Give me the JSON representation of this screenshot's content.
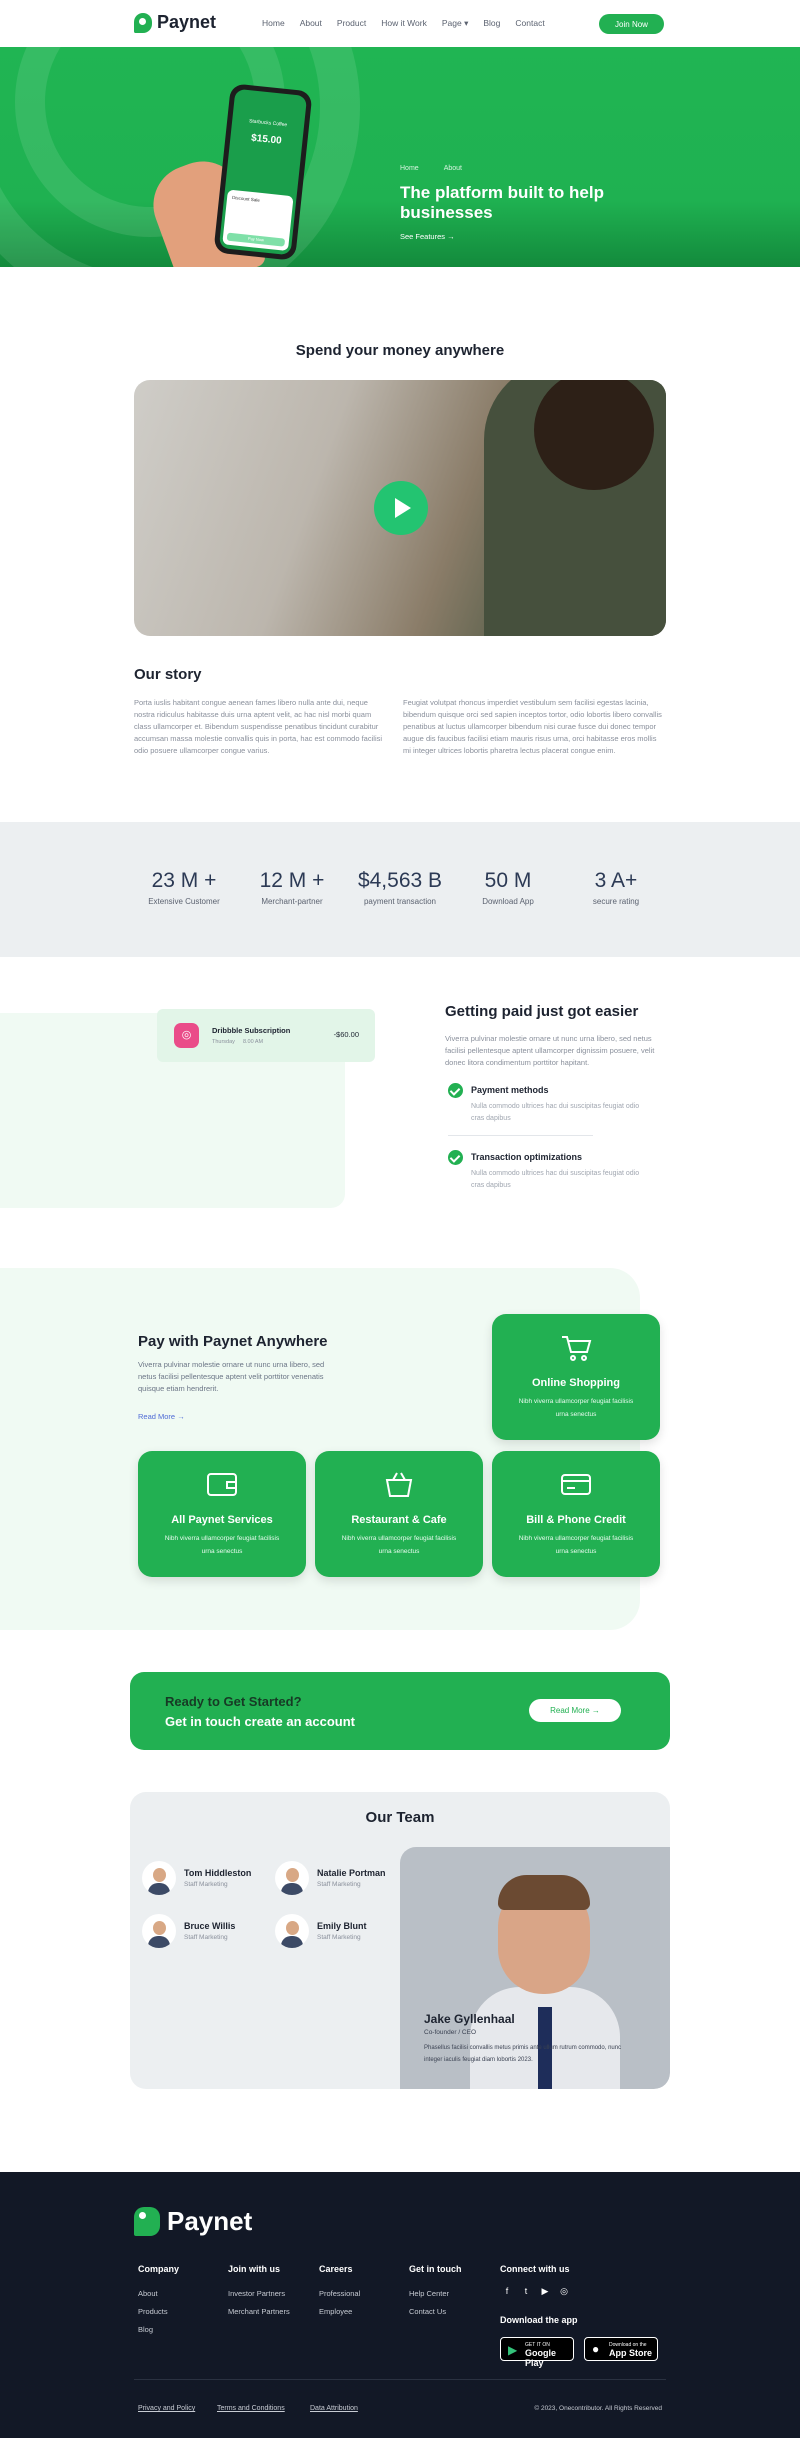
{
  "nav": {
    "brand": "Paynet",
    "menu": [
      "Home",
      "About",
      "Product",
      "How it Work",
      "Page",
      "Blog",
      "Contact"
    ],
    "join_label": "Join Now"
  },
  "hero": {
    "crumb_home": "Home",
    "crumb_current": "About",
    "title": "The platform built to help businesses",
    "link_label": "See Features",
    "phone": {
      "header": "Starbucks Coffee",
      "amount": "$15.00",
      "label": "Discount Sale",
      "button": "Pay Now"
    }
  },
  "spend": {
    "title": "Spend your money anywhere"
  },
  "story": {
    "title": "Our story",
    "col1": "Porta iuslis habitant congue aenean fames libero nulla ante dui, neque nostra ridiculus habitasse duis urna aptent velit, ac hac nisl morbi quam class ullamcorper et. Bibendum suspendisse penatibus tincidunt curabitur accumsan massa molestie convallis quis in porta, hac est commodo facilisi odio posuere ullamcorper congue varius.",
    "col2": "Feugiat volutpat rhoncus imperdiet vestibulum sem facilisi egestas lacinia, bibendum quisque orci sed sapien inceptos tortor, odio lobortis libero convallis penatibus at luctus ullamcorper bibendum nisi curae fusce dui donec tempor augue dis faucibus facilisi etiam mauris risus urna, orci habitasse eros mollis mi integer ultrices lobortis pharetra lectus placerat congue enim."
  },
  "stats": [
    {
      "value": "23 M +",
      "label": "Extensive Customer"
    },
    {
      "value": "12 M +",
      "label": "Merchant-partner"
    },
    {
      "value": "$4,563 B",
      "label": "payment transaction"
    },
    {
      "value": "50 M",
      "label": "Download App"
    },
    {
      "value": "3 A+",
      "label": "secure rating"
    }
  ],
  "getting_paid": {
    "title": "Getting paid just got easier",
    "text": "Viverra pulvinar molestie ornare ut nunc urna libero, sed netus facilisi pellentesque aptent ullamcorper dignissim posuere, velit donec litora condimentum porttitor hapitant.",
    "subscription": {
      "name": "Dribbble Subscription",
      "meta_date": "Thursday",
      "meta_time": "8.00 AM",
      "amount": "-$60.00"
    },
    "features": [
      {
        "title": "Payment methods",
        "desc": "Nulla commodo ultrices hac dui suscipitas feugiat odio cras dapibus"
      },
      {
        "title": "Transaction optimizations",
        "desc": "Nulla commodo ultrices hac dui suscipitas feugiat odio cras dapibus"
      }
    ]
  },
  "pay_anywhere": {
    "title": "Pay with Paynet Anywhere",
    "text": "Viverra pulvinar molestie ornare ut nunc urna libero, sed netus facilisi pellentesque aptent velit porttitor venenatis quisque etiam hendrerit.",
    "read_more": "Read More",
    "cards": [
      {
        "title": "Online Shopping",
        "desc": "Nibh viverra ullamcorper feugiat facilisis urna senectus"
      },
      {
        "title": "All Paynet Services",
        "desc": "Nibh viverra ullamcorper feugiat facilisis urna senectus"
      },
      {
        "title": "Restaurant & Cafe",
        "desc": "Nibh viverra ullamcorper feugiat facilisis urna senectus"
      },
      {
        "title": "Bill & Phone Credit",
        "desc": "Nibh viverra ullamcorper feugiat facilisis urna senectus"
      }
    ]
  },
  "cta": {
    "line1": "Ready to Get Started?",
    "line2": "Get in touch create an account",
    "button": "Read More"
  },
  "team": {
    "title": "Our Team",
    "members": [
      {
        "name": "Tom Hiddleston",
        "role": "Staff Marketing"
      },
      {
        "name": "Natalie Portman",
        "role": "Staff Marketing"
      },
      {
        "name": "Bruce Willis",
        "role": "Staff Marketing"
      },
      {
        "name": "Emily Blunt",
        "role": "Staff Marketing"
      }
    ],
    "featured": {
      "name": "Jake Gyllenhaal",
      "role": "Co-founder / CEO",
      "quote": "Phasellus facilisi convallis metus primis ante ullum rutrum commodo, nunc integer iaculis feugiat diam lobortis 2023."
    }
  },
  "footer": {
    "brand": "Paynet",
    "columns": [
      {
        "title": "Company",
        "links": [
          "About",
          "Products",
          "Blog"
        ]
      },
      {
        "title": "Join with us",
        "links": [
          "Investor Partners",
          "Merchant Partners"
        ]
      },
      {
        "title": "Careers",
        "links": [
          "Professional",
          "Employee"
        ]
      },
      {
        "title": "Get in touch",
        "links": [
          "Help Center",
          "Contact Us"
        ]
      }
    ],
    "connect_title": "Connect with us",
    "download_title": "Download the app",
    "google_small": "GET IT ON",
    "google_big": "Google Play",
    "apple_small": "Download on the",
    "apple_big": "App Store",
    "legal": [
      "Privacy and Policy",
      "Terms and Conditions",
      "Data Attribution"
    ],
    "copyright": "© 2023, Onecontributor. All Rights Reserved"
  },
  "colors": {
    "brand": "#22b052",
    "dark": "#121826",
    "muted": "#eceff1"
  }
}
